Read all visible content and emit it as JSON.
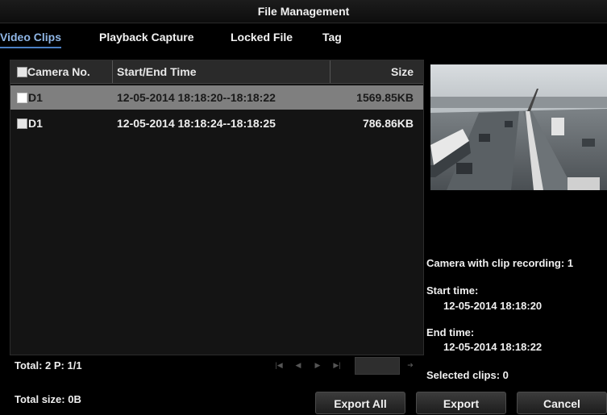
{
  "window": {
    "title": "File Management"
  },
  "tabs": [
    {
      "label": "Video Clips",
      "active": true
    },
    {
      "label": "Playback Capture",
      "active": false
    },
    {
      "label": "Locked File",
      "active": false
    },
    {
      "label": "Tag",
      "active": false
    }
  ],
  "table": {
    "headers": {
      "camera": "Camera No.",
      "time": "Start/End Time",
      "size": "Size"
    },
    "rows": [
      {
        "camera": "D1",
        "time": "12-05-2014 18:18:20--18:18:22",
        "size": "1569.85KB",
        "selected": true
      },
      {
        "camera": "D1",
        "time": "12-05-2014 18:18:24--18:18:25",
        "size": "786.86KB",
        "selected": false
      }
    ]
  },
  "pagination": {
    "summary": "Total: 2  P: 1/1",
    "icons": [
      "first-page-icon",
      "prev-page-icon",
      "next-page-icon",
      "last-page-icon",
      "go-icon"
    ]
  },
  "details": {
    "camera_label": "Camera with clip recording: 1",
    "start_label": "Start time:",
    "start_value": "12-05-2014 18:18:20",
    "end_label": "End time:",
    "end_value": "12-05-2014 18:18:22",
    "selected_label": "Selected clips: 0"
  },
  "footer": {
    "total_size": "Total size: 0B",
    "buttons": {
      "export_all": "Export All",
      "export": "Export",
      "cancel": "Cancel"
    }
  },
  "colors": {
    "accent": "#4a7fc4",
    "selected_row": "#7f7f7f",
    "background": "#000000"
  }
}
